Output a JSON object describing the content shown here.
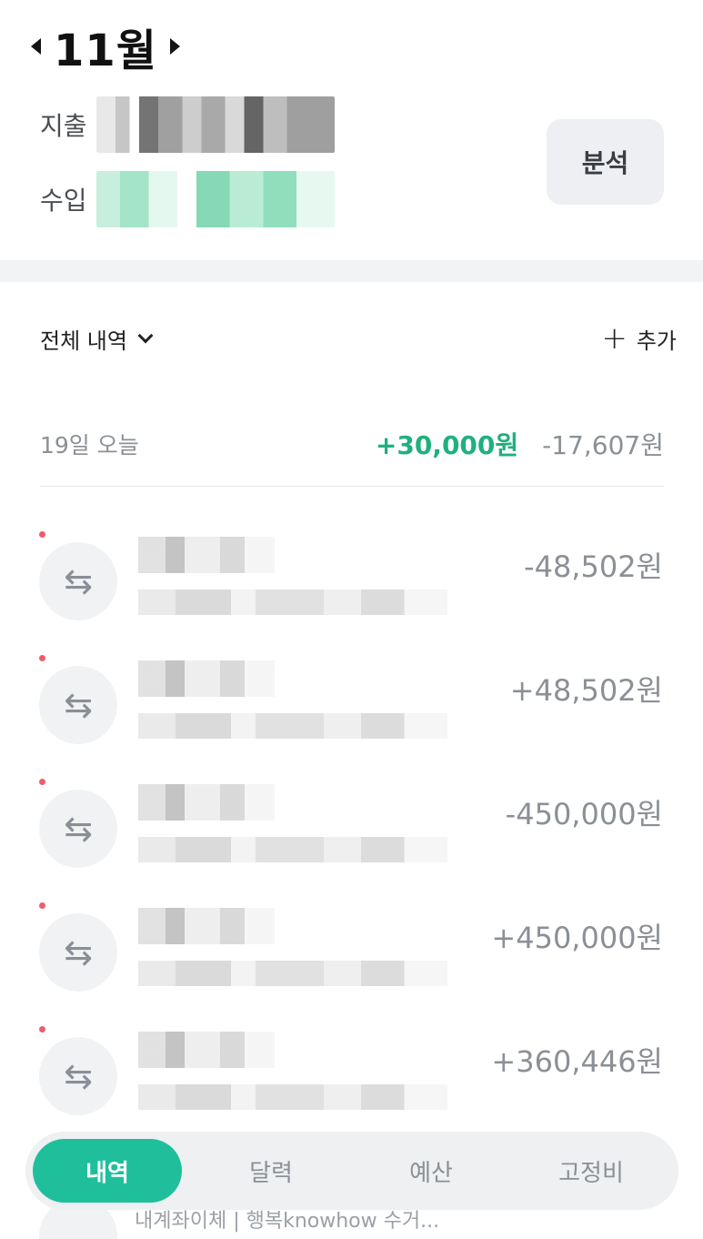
{
  "header": {
    "month": "11월",
    "prev_icon": "triangle-left-icon",
    "next_icon": "triangle-right-icon"
  },
  "summary": {
    "expense_label": "지출",
    "income_label": "수입",
    "analysis_label": "분석"
  },
  "filter": {
    "label": "전체 내역",
    "add_label": "추가"
  },
  "day": {
    "label": "19일 오늘",
    "income_total": "+30,000원",
    "expense_total": "-17,607원"
  },
  "transactions": [
    {
      "amount": "-48,502원",
      "icon": "transfer-icon"
    },
    {
      "amount": "+48,502원",
      "icon": "transfer-icon"
    },
    {
      "amount": "-450,000원",
      "icon": "transfer-icon"
    },
    {
      "amount": "+450,000원",
      "icon": "transfer-icon"
    },
    {
      "amount": "+360,446원",
      "icon": "transfer-icon"
    }
  ],
  "bottom_nav": {
    "tabs": [
      "내역",
      "달력",
      "예산",
      "고정비"
    ],
    "active": "내역"
  },
  "peek": {
    "text": "내계좌이체 | 행복knowhow 수거..."
  },
  "colors": {
    "accent": "#1fbf9c",
    "income": "#1fb07d",
    "unread_dot": "#ee5d6c"
  }
}
